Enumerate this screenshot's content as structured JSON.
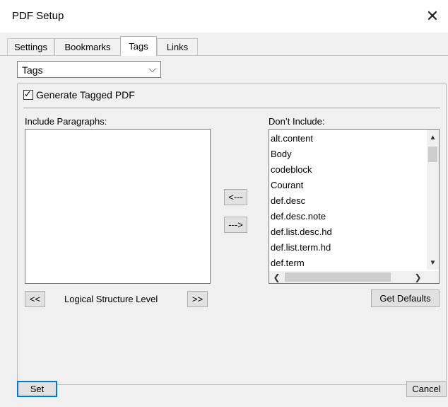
{
  "window": {
    "title": "PDF Setup",
    "close_glyph": "✕"
  },
  "tabs": [
    {
      "label": "Settings"
    },
    {
      "label": "Bookmarks"
    },
    {
      "label": "Tags"
    },
    {
      "label": "Links"
    }
  ],
  "active_tab": "Tags",
  "combo": {
    "value": "Tags",
    "arrow_glyph": "⌵"
  },
  "tagged_pdf": {
    "label": "Generate Tagged PDF",
    "checked": true,
    "mark": "✓"
  },
  "include": {
    "label": "Include Paragraphs:",
    "items": []
  },
  "exclude": {
    "label": "Don’t Include:",
    "items": [
      "alt.content",
      "Body",
      "codeblock",
      "Courant",
      "def.desc",
      "def.desc.note",
      "def.list.desc.hd",
      "def.list.term.hd",
      "def.term"
    ]
  },
  "scroll_glyphs": {
    "up": "▲",
    "down": "▼",
    "left": "❮",
    "right": "❯"
  },
  "move_buttons": {
    "to_include": "<---",
    "to_exclude": "--->"
  },
  "level": {
    "decrease": "<<",
    "label": "Logical Structure Level",
    "increase": ">>"
  },
  "buttons": {
    "get_defaults": "Get Defaults",
    "set": "Set",
    "cancel": "Cancel"
  }
}
